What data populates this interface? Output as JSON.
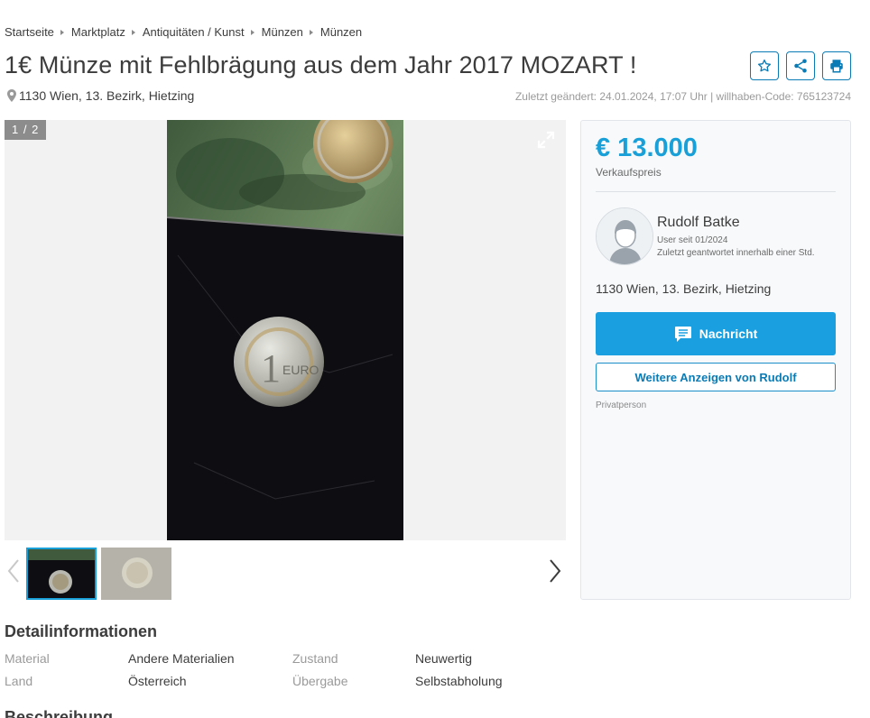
{
  "breadcrumb": [
    "Startseite",
    "Marktplatz",
    "Antiquitäten / Kunst",
    "Münzen",
    "Münzen"
  ],
  "listing": {
    "title": "1€ Münze mit Fehlbrägung aus dem Jahr 2017 MOZART !",
    "location": "1130 Wien, 13. Bezirk, Hietzing",
    "meta": "Zuletzt geändert: 24.01.2024, 17:07 Uhr | willhaben-Code: 765123724"
  },
  "actions": {
    "favorite_icon": "star-icon",
    "share_icon": "share-icon",
    "print_icon": "print-icon"
  },
  "gallery": {
    "counter": "1 / 2",
    "expand_icon": "expand-icon",
    "prev_icon": "chevron-left-icon",
    "next_icon": "chevron-right-icon",
    "thumbnails": [
      "coin-photo-1",
      "coin-photo-2"
    ]
  },
  "seller": {
    "price": "€ 13.000",
    "price_label": "Verkaufspreis",
    "name": "Rudolf Batke",
    "user_since": "User seit 01/2024",
    "reply_time": "Zuletzt geantwortet innerhalb einer Std.",
    "location": "1130 Wien, 13. Bezirk, Hietzing",
    "message_button": "Nachricht",
    "more_ads_button": "Weitere Anzeigen von Rudolf",
    "seller_type": "Privatperson"
  },
  "details": {
    "heading": "Detailinformationen",
    "rows": [
      {
        "key": "Material",
        "value": "Andere Materialien"
      },
      {
        "key": "Zustand",
        "value": "Neuwertig"
      },
      {
        "key": "Land",
        "value": "Österreich"
      },
      {
        "key": "Übergabe",
        "value": "Selbstabholung"
      }
    ]
  },
  "description": {
    "heading": "Beschreibung"
  },
  "colors": {
    "accent": "#1aa0d8",
    "button": "#1aa0e0",
    "border_blue": "#0a7bb5",
    "text": "#3c3c3c",
    "muted": "#9a9a9a"
  }
}
